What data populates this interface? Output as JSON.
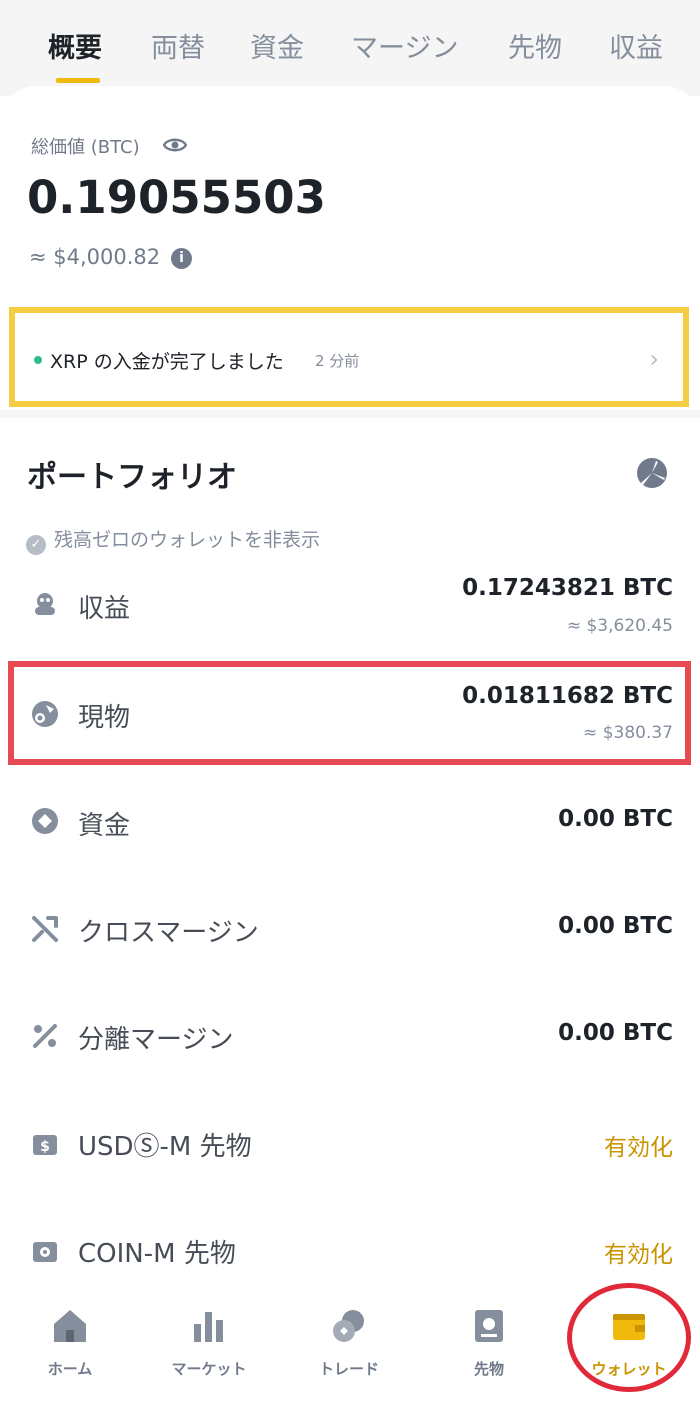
{
  "tabs": [
    "概要",
    "両替",
    "資金",
    "マージン",
    "先物",
    "収益"
  ],
  "summary": {
    "label": "総価値 (BTC)",
    "value": "0.19055503",
    "usd": "≈ $4,000.82"
  },
  "notice": {
    "text": "XRP の入金が完了しました",
    "time": "2 分前"
  },
  "portfolio": {
    "title": "ポートフォリオ",
    "hide_zero": "残高ゼロのウォレットを非表示",
    "rows": [
      {
        "label": "収益",
        "amount": "0.17243821 BTC",
        "usd": "≈ $3,620.45",
        "icon": "earn-icon"
      },
      {
        "label": "現物",
        "amount": "0.01811682 BTC",
        "usd": "≈ $380.37",
        "icon": "spot-icon"
      },
      {
        "label": "資金",
        "amount": "0.00 BTC",
        "icon": "funding-icon"
      },
      {
        "label": "クロスマージン",
        "amount": "0.00 BTC",
        "icon": "cross-margin-icon"
      },
      {
        "label": "分離マージン",
        "amount": "0.00 BTC",
        "icon": "isolated-margin-icon"
      },
      {
        "label": "USDⓈ-M 先物",
        "action": "有効化",
        "icon": "usdm-futures-icon"
      },
      {
        "label": "COIN-M 先物",
        "action": "有効化",
        "icon": "coinm-futures-icon"
      }
    ]
  },
  "nav": [
    {
      "label": "ホーム",
      "icon": "home-icon"
    },
    {
      "label": "マーケット",
      "icon": "markets-icon"
    },
    {
      "label": "トレード",
      "icon": "trade-icon"
    },
    {
      "label": "先物",
      "icon": "futures-icon"
    },
    {
      "label": "ウォレット",
      "icon": "wallet-icon",
      "active": true
    }
  ],
  "colors": {
    "accent": "#f0b90b",
    "notice_highlight": "#f5cd43",
    "spot_highlight": "#e84a54",
    "wallet_circle": "#e02a3a",
    "positive_dot": "#2ebd85"
  }
}
